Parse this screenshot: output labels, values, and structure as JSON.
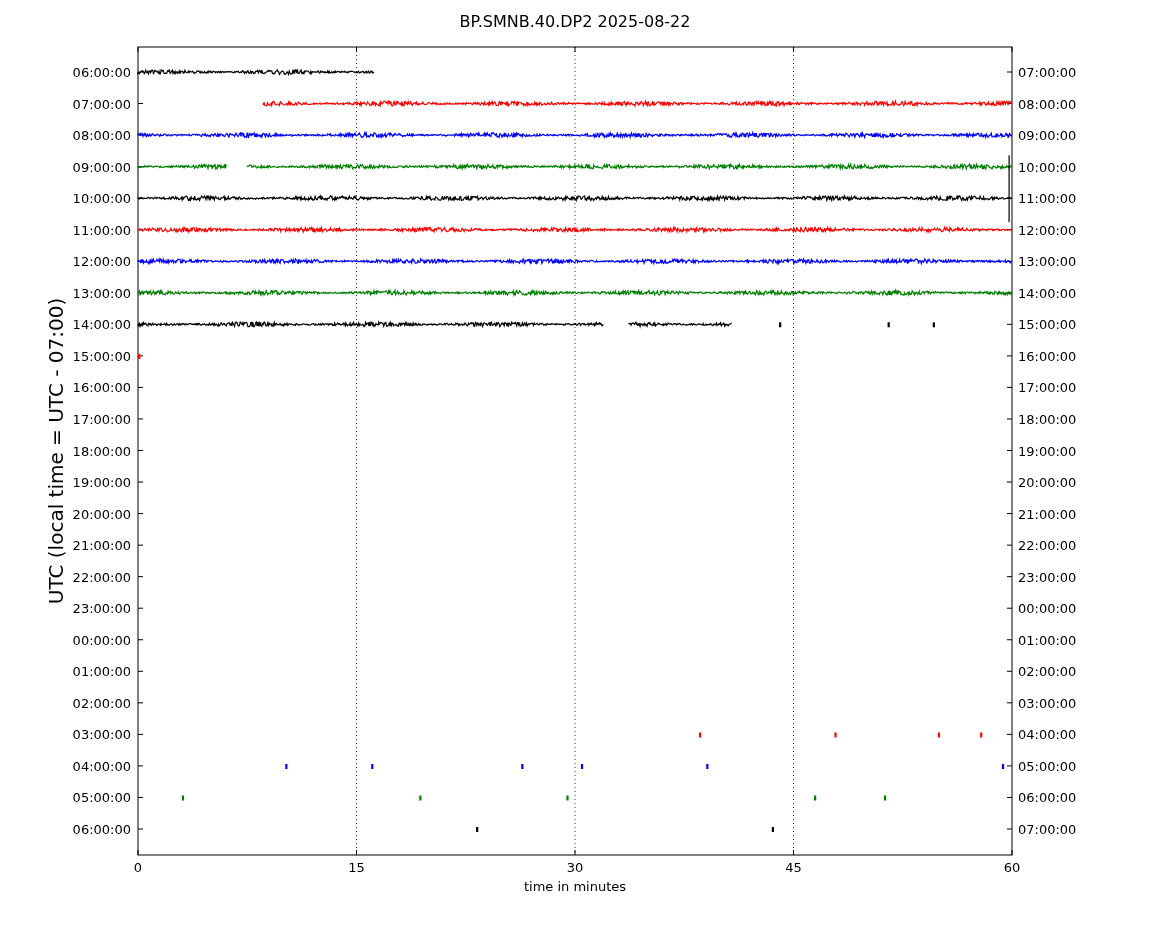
{
  "title": "BP.SMNB.40.DP2 2025-08-22",
  "plot": {
    "ylabel": "UTC (local time = UTC - 07:00)",
    "xlabel": "time in minutes",
    "left_ticks": [
      "06:00:00",
      "07:00:00",
      "08:00:00",
      "09:00:00",
      "10:00:00",
      "11:00:00",
      "12:00:00",
      "13:00:00",
      "14:00:00",
      "15:00:00",
      "16:00:00",
      "17:00:00",
      "18:00:00",
      "19:00:00",
      "20:00:00",
      "21:00:00",
      "22:00:00",
      "23:00:00",
      "00:00:00",
      "01:00:00",
      "02:00:00",
      "03:00:00",
      "04:00:00",
      "05:00:00",
      "06:00:00"
    ],
    "right_ticks": [
      "07:00:00",
      "08:00:00",
      "09:00:00",
      "10:00:00",
      "11:00:00",
      "12:00:00",
      "13:00:00",
      "14:00:00",
      "15:00:00",
      "16:00:00",
      "17:00:00",
      "18:00:00",
      "19:00:00",
      "20:00:00",
      "21:00:00",
      "22:00:00",
      "23:00:00",
      "00:00:00",
      "01:00:00",
      "02:00:00",
      "03:00:00",
      "04:00:00",
      "05:00:00",
      "06:00:00",
      "07:00:00"
    ],
    "xticks": [
      "0",
      "15",
      "30",
      "45",
      "60"
    ]
  }
}
